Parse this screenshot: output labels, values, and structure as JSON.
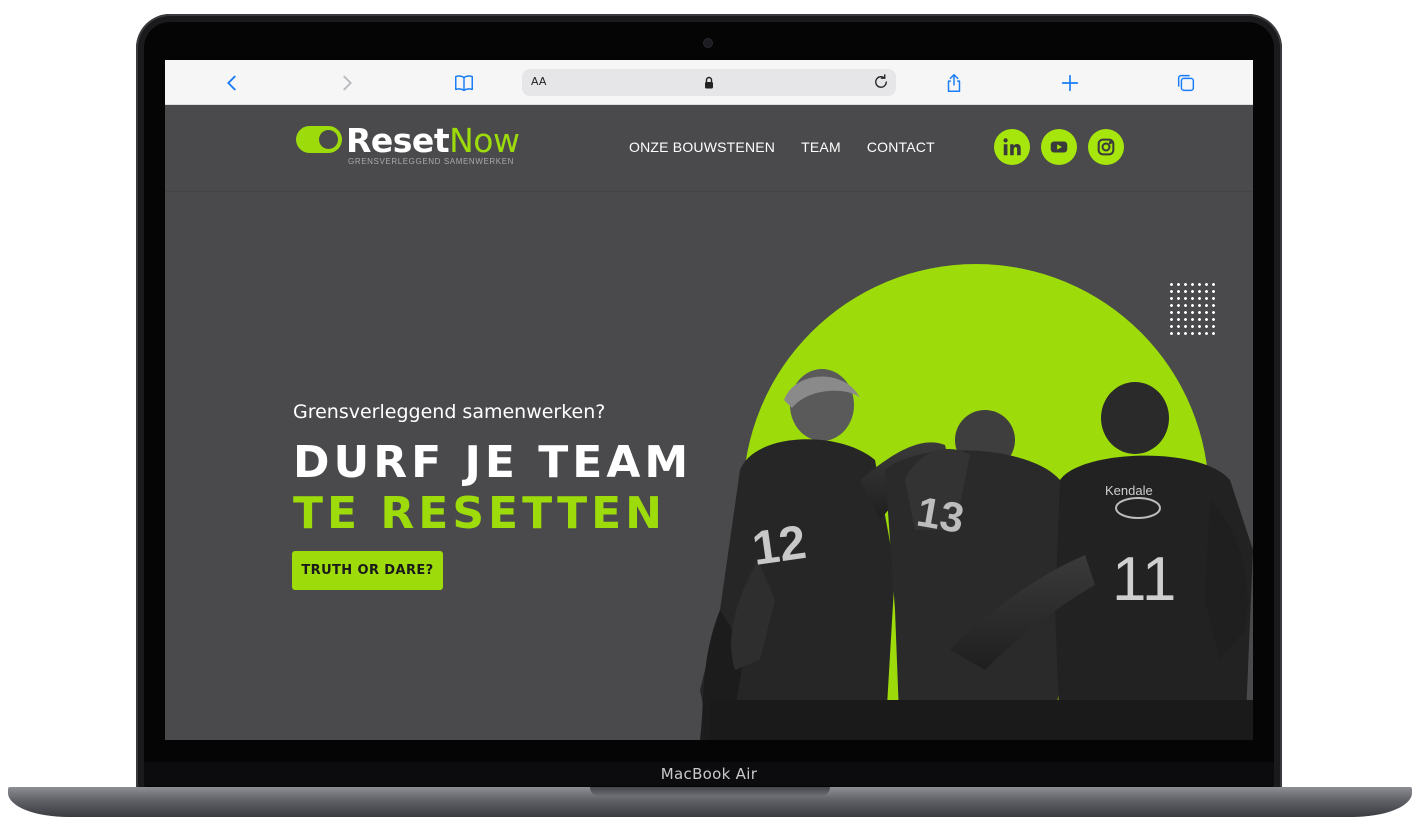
{
  "device": {
    "model_label": "MacBook Air"
  },
  "browser": {
    "address_text_size_label": "AA",
    "icons": [
      "chevron-left-icon",
      "chevron-right-icon",
      "book-icon",
      "lock-icon",
      "reload-icon",
      "share-icon",
      "plus-icon",
      "tabs-icon"
    ]
  },
  "site": {
    "logo": {
      "word_part1": "Reset",
      "word_part2": "Now",
      "tagline": "GRENSVERLEGGEND SAMENWERKEN"
    },
    "nav": [
      {
        "label": "ONZE BOUWSTENEN"
      },
      {
        "label": "TEAM"
      },
      {
        "label": "CONTACT"
      }
    ],
    "social": [
      "linkedin-icon",
      "youtube-icon",
      "instagram-icon"
    ],
    "hero": {
      "subtitle": "Grensverleggend samenwerken?",
      "headline_line1": "DURF JE TEAM",
      "headline_line2": "TE RESETTEN",
      "cta_label": "TRUTH OR DARE?"
    },
    "colors": {
      "accent": "#9ddb0a",
      "background": "#4a4a4d",
      "text": "#ffffff"
    }
  }
}
